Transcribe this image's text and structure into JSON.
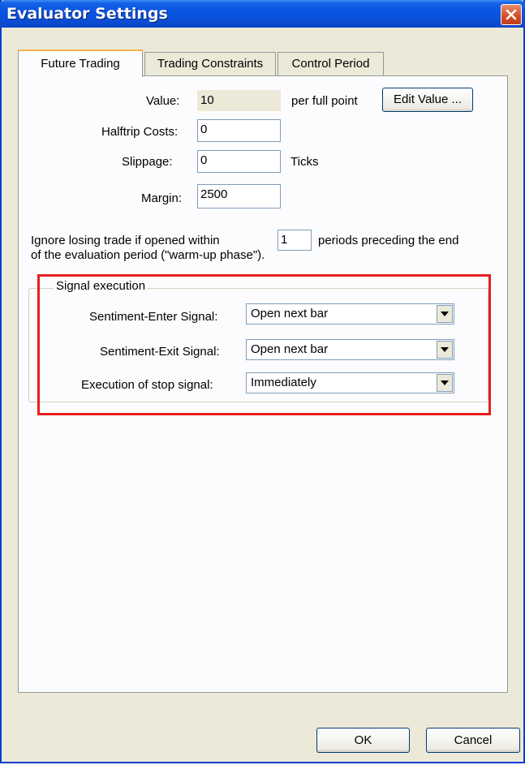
{
  "window": {
    "title": "Evaluator Settings"
  },
  "tabs": [
    {
      "label": "Future Trading",
      "active": true
    },
    {
      "label": "Trading Constraints",
      "active": false
    },
    {
      "label": "Control Period",
      "active": false
    }
  ],
  "fields": {
    "value": {
      "label": "Value:",
      "value": "10",
      "suffix": "per full point"
    },
    "edit_value_button": "Edit Value ...",
    "halftrip": {
      "label": "Halftrip Costs:",
      "value": "0"
    },
    "slippage": {
      "label": "Slippage:",
      "value": "0",
      "suffix": "Ticks"
    },
    "margin": {
      "label": "Margin:",
      "value": "2500"
    }
  },
  "warmup": {
    "prefix": "Ignore losing trade if opened within",
    "value": "1",
    "suffix": "periods preceding the end",
    "line2": "of the evaluation period (\"warm-up phase\")."
  },
  "signal_execution": {
    "title": "Signal execution",
    "enter": {
      "label": "Sentiment-Enter Signal:",
      "value": "Open next bar"
    },
    "exit": {
      "label": "Sentiment-Exit Signal:",
      "value": "Open next bar"
    },
    "stop": {
      "label": "Execution of stop signal:",
      "value": "Immediately"
    }
  },
  "buttons": {
    "ok": "OK",
    "cancel": "Cancel"
  },
  "colors": {
    "titlebar": "#0a50d8",
    "highlight": "#e61e1e",
    "panel": "#fcfcfe",
    "dialog": "#ece9d8"
  }
}
